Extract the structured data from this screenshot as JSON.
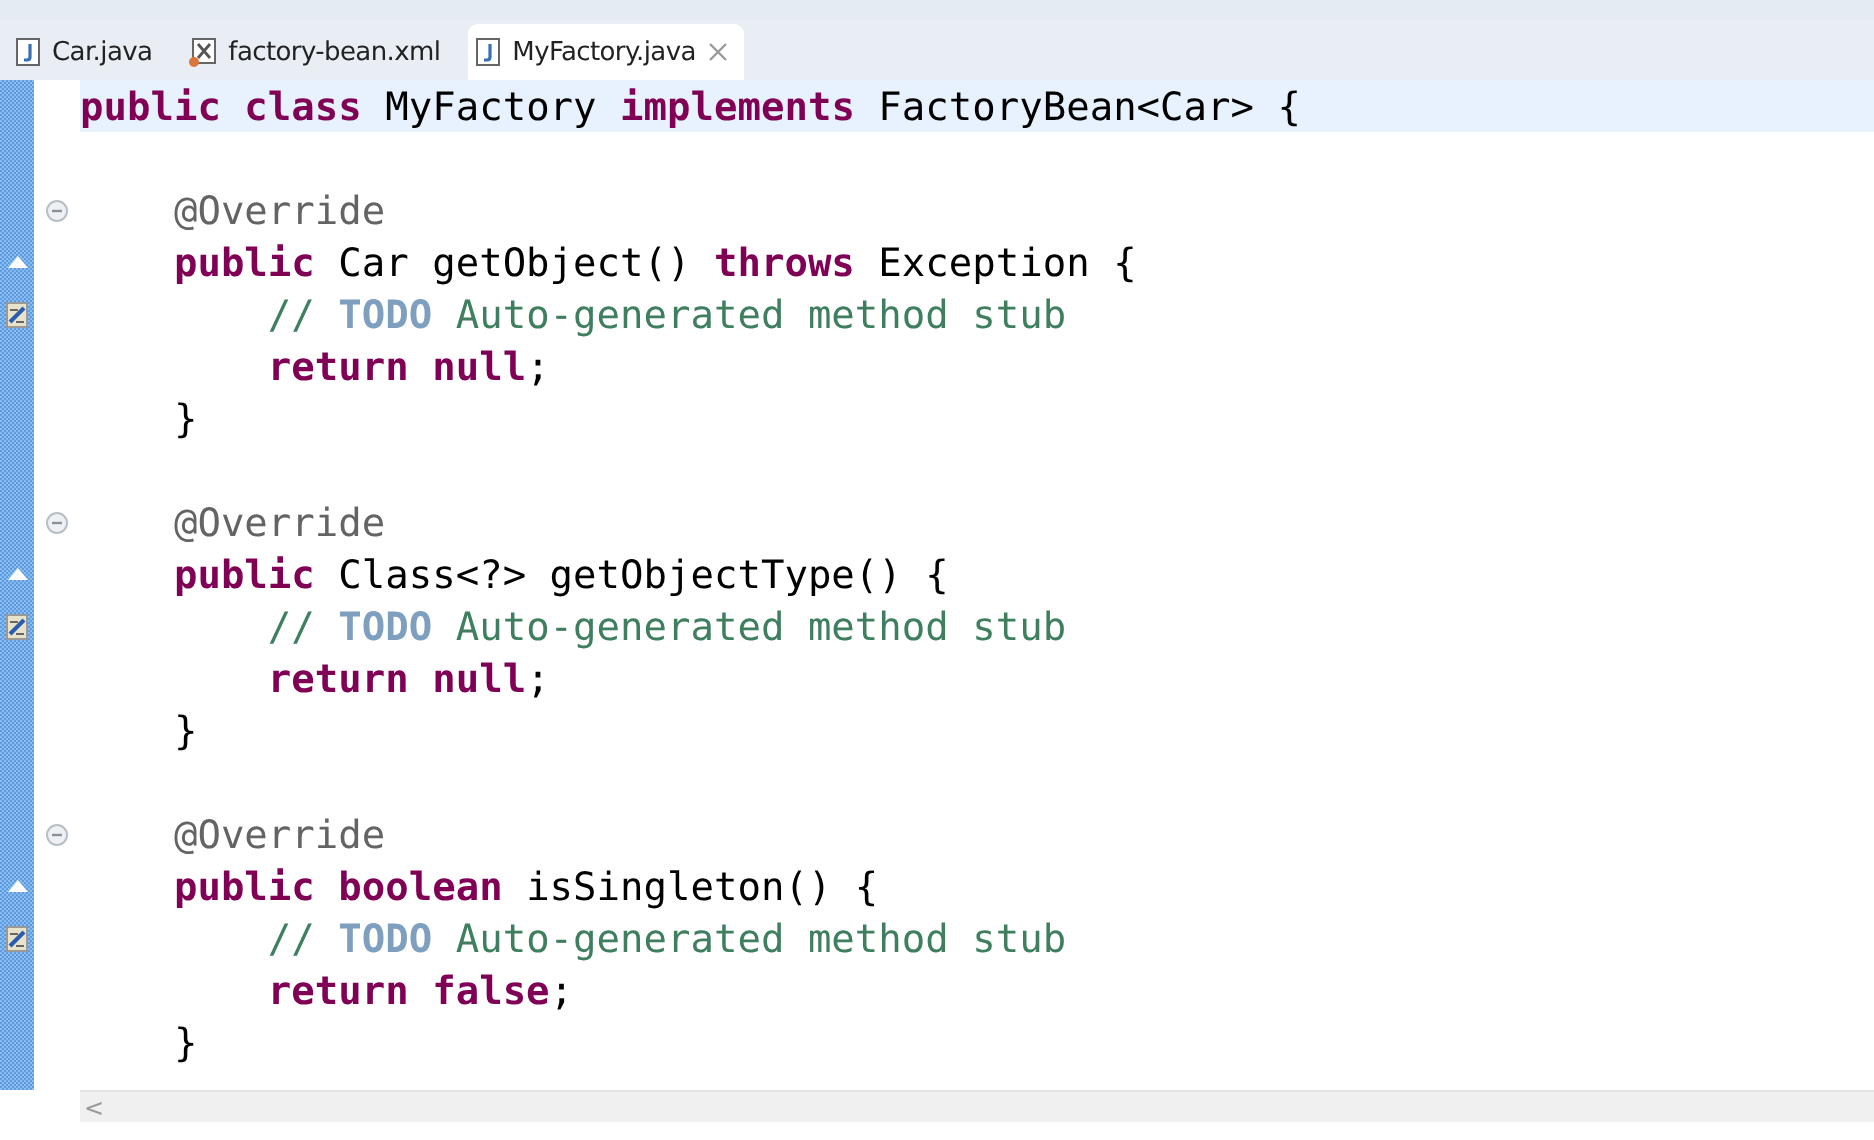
{
  "tabs": [
    {
      "label": "Car.java",
      "kind": "java",
      "selected": false
    },
    {
      "label": "factory-bean.xml",
      "kind": "xml",
      "selected": false
    },
    {
      "label": "MyFactory.java",
      "kind": "java",
      "selected": true
    }
  ],
  "lines": [
    {
      "current": true,
      "kind": "plain",
      "tokens": [
        {
          "kind": "kw",
          "text": "public class "
        },
        {
          "kind": "plain",
          "text": "MyFactory "
        },
        {
          "kind": "kw",
          "text": "implements "
        },
        {
          "kind": "plain",
          "text": "FactoryBean<Car> {"
        }
      ]
    },
    {
      "current": false,
      "kind": "blank"
    },
    {
      "current": false,
      "kind": "annotation",
      "tokens": [
        {
          "kind": "ann",
          "text": "    @Override"
        }
      ]
    },
    {
      "current": false,
      "kind": "override",
      "tokens": [
        {
          "kind": "kw",
          "text": "    public "
        },
        {
          "kind": "plain",
          "text": "Car getObject() "
        },
        {
          "kind": "kw",
          "text": "throws "
        },
        {
          "kind": "plain",
          "text": "Exception {"
        }
      ]
    },
    {
      "current": false,
      "kind": "task",
      "tokens": [
        {
          "kind": "comment",
          "text": "        // "
        },
        {
          "kind": "todo",
          "text": "TODO "
        },
        {
          "kind": "comment",
          "text": "Auto-generated method stub"
        }
      ]
    },
    {
      "current": false,
      "kind": "plain",
      "tokens": [
        {
          "kind": "kw",
          "text": "        return null"
        },
        {
          "kind": "plain",
          "text": ";"
        }
      ]
    },
    {
      "current": false,
      "kind": "plain",
      "tokens": [
        {
          "kind": "plain",
          "text": "    }"
        }
      ]
    },
    {
      "current": false,
      "kind": "blank"
    },
    {
      "current": false,
      "kind": "annotation",
      "tokens": [
        {
          "kind": "ann",
          "text": "    @Override"
        }
      ]
    },
    {
      "current": false,
      "kind": "override",
      "tokens": [
        {
          "kind": "kw",
          "text": "    public "
        },
        {
          "kind": "plain",
          "text": "Class<?> getObjectType() {"
        }
      ]
    },
    {
      "current": false,
      "kind": "task",
      "tokens": [
        {
          "kind": "comment",
          "text": "        // "
        },
        {
          "kind": "todo",
          "text": "TODO "
        },
        {
          "kind": "comment",
          "text": "Auto-generated method stub"
        }
      ]
    },
    {
      "current": false,
      "kind": "plain",
      "tokens": [
        {
          "kind": "kw",
          "text": "        return null"
        },
        {
          "kind": "plain",
          "text": ";"
        }
      ]
    },
    {
      "current": false,
      "kind": "plain",
      "tokens": [
        {
          "kind": "plain",
          "text": "    }"
        }
      ]
    },
    {
      "current": false,
      "kind": "blank"
    },
    {
      "current": false,
      "kind": "annotation",
      "tokens": [
        {
          "kind": "ann",
          "text": "    @Override"
        }
      ]
    },
    {
      "current": false,
      "kind": "override",
      "tokens": [
        {
          "kind": "kw",
          "text": "    public boolean "
        },
        {
          "kind": "plain",
          "text": "isSingleton() {"
        }
      ]
    },
    {
      "current": false,
      "kind": "task",
      "tokens": [
        {
          "kind": "comment",
          "text": "        // "
        },
        {
          "kind": "todo",
          "text": "TODO "
        },
        {
          "kind": "comment",
          "text": "Auto-generated method stub"
        }
      ]
    },
    {
      "current": false,
      "kind": "plain",
      "tokens": [
        {
          "kind": "kw",
          "text": "        return false"
        },
        {
          "kind": "plain",
          "text": ";"
        }
      ]
    },
    {
      "current": false,
      "kind": "plain",
      "tokens": [
        {
          "kind": "plain",
          "text": "    }"
        }
      ]
    }
  ],
  "scrollbar": {
    "arrow": "<"
  }
}
